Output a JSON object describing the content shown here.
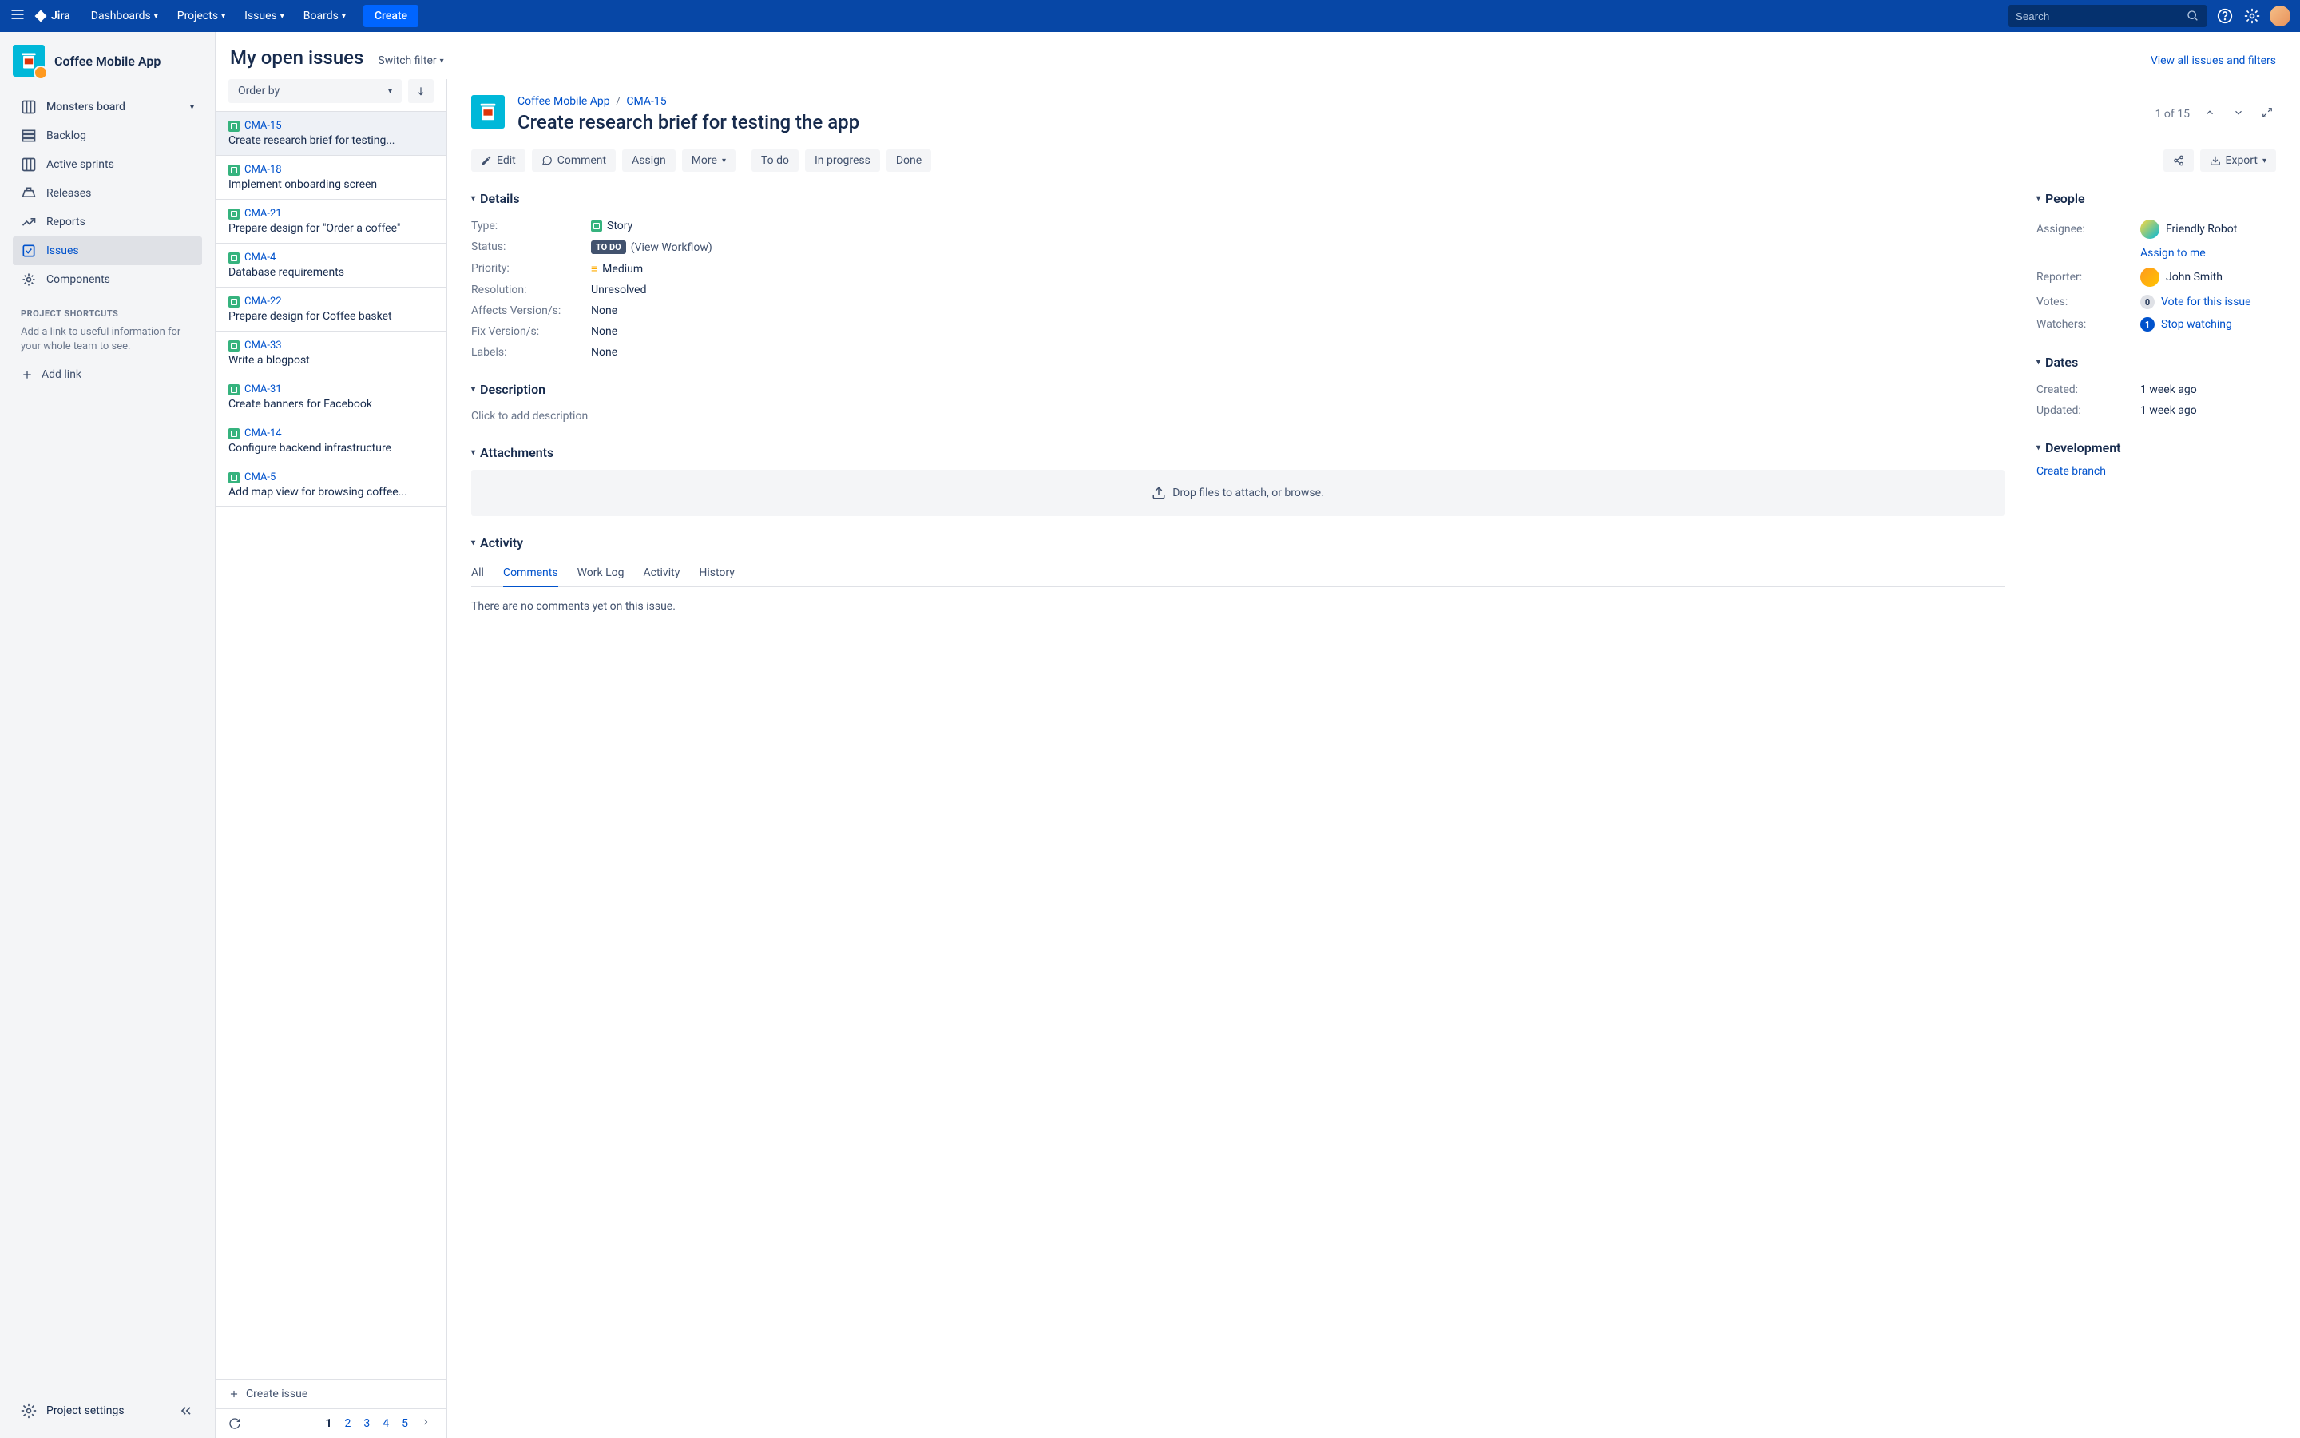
{
  "topnav": {
    "logo": "Jira",
    "items": [
      "Dashboards",
      "Projects",
      "Issues",
      "Boards"
    ],
    "create": "Create",
    "search_placeholder": "Search"
  },
  "sidebar": {
    "project_name": "Coffee Mobile App",
    "board_name": "Monsters board",
    "items": [
      {
        "label": "Backlog"
      },
      {
        "label": "Active sprints"
      },
      {
        "label": "Releases"
      },
      {
        "label": "Reports"
      },
      {
        "label": "Issues"
      },
      {
        "label": "Components"
      }
    ],
    "shortcuts_heading": "PROJECT SHORTCUTS",
    "shortcuts_help": "Add a link to useful information for your whole team to see.",
    "add_link": "Add link",
    "settings": "Project settings"
  },
  "page": {
    "title": "My open issues",
    "switch_filter": "Switch filter",
    "view_all": "View all issues and filters"
  },
  "list": {
    "order_by": "Order by",
    "issues": [
      {
        "key": "CMA-15",
        "title": "Create research brief for testing..."
      },
      {
        "key": "CMA-18",
        "title": "Implement onboarding screen"
      },
      {
        "key": "CMA-21",
        "title": "Prepare design for \"Order a coffee\""
      },
      {
        "key": "CMA-4",
        "title": "Database requirements"
      },
      {
        "key": "CMA-22",
        "title": "Prepare design for Coffee basket"
      },
      {
        "key": "CMA-33",
        "title": "Write a blogpost"
      },
      {
        "key": "CMA-31",
        "title": "Create banners for Facebook"
      },
      {
        "key": "CMA-14",
        "title": "Configure backend infrastructure"
      },
      {
        "key": "CMA-5",
        "title": "Add map view for browsing coffee..."
      }
    ],
    "create_issue": "Create issue",
    "pages": [
      "1",
      "2",
      "3",
      "4",
      "5"
    ]
  },
  "detail": {
    "breadcrumb_project": "Coffee Mobile App",
    "breadcrumb_key": "CMA-15",
    "title": "Create research brief for testing the app",
    "position": "1 of 15",
    "toolbar": {
      "edit": "Edit",
      "comment": "Comment",
      "assign": "Assign",
      "more": "More",
      "todo": "To do",
      "inprogress": "In progress",
      "done": "Done",
      "export": "Export"
    },
    "details": {
      "heading": "Details",
      "type_label": "Type:",
      "type_value": "Story",
      "status_label": "Status:",
      "status_badge": "TO DO",
      "status_link": "(View Workflow)",
      "priority_label": "Priority:",
      "priority_value": "Medium",
      "resolution_label": "Resolution:",
      "resolution_value": "Unresolved",
      "affects_label": "Affects Version/s:",
      "affects_value": "None",
      "fix_label": "Fix Version/s:",
      "fix_value": "None",
      "labels_label": "Labels:",
      "labels_value": "None"
    },
    "description": {
      "heading": "Description",
      "placeholder": "Click to add description"
    },
    "attachments": {
      "heading": "Attachments",
      "dropzone": "Drop files to attach, or browse."
    },
    "activity": {
      "heading": "Activity",
      "tabs": [
        "All",
        "Comments",
        "Work Log",
        "Activity",
        "History"
      ],
      "no_comments": "There are no comments yet on this issue."
    },
    "people": {
      "heading": "People",
      "assignee_label": "Assignee:",
      "assignee_value": "Friendly Robot",
      "assign_to_me": "Assign to me",
      "reporter_label": "Reporter:",
      "reporter_value": "John Smith",
      "votes_label": "Votes:",
      "votes_count": "0",
      "vote_link": "Vote for this issue",
      "watchers_label": "Watchers:",
      "watchers_count": "1",
      "watch_link": "Stop watching"
    },
    "dates": {
      "heading": "Dates",
      "created_label": "Created:",
      "created_value": "1 week ago",
      "updated_label": "Updated:",
      "updated_value": "1 week ago"
    },
    "development": {
      "heading": "Development",
      "create_branch": "Create branch"
    }
  }
}
